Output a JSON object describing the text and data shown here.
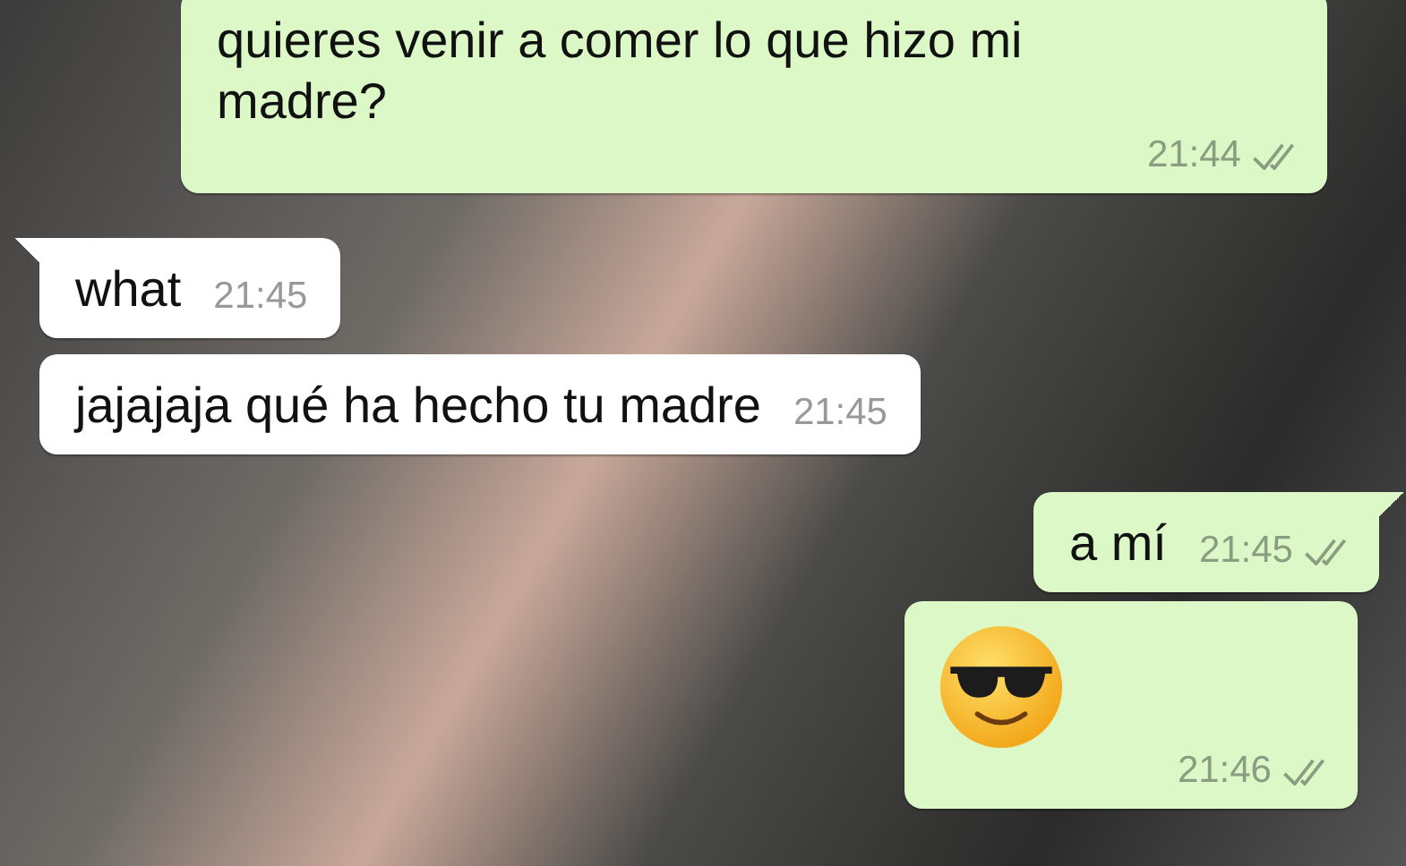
{
  "messages": [
    {
      "kind": "sent_text",
      "text": "quieres venir a comer lo que hizo mi madre?",
      "time": "21:44",
      "tail": false
    },
    {
      "kind": "received_text",
      "text": "what",
      "time": "21:45",
      "tail": true
    },
    {
      "kind": "received_text",
      "text": "jajajaja qué ha hecho tu madre",
      "time": "21:45",
      "tail": false
    },
    {
      "kind": "sent_text",
      "text": "a mí",
      "time": "21:45",
      "tail": true
    },
    {
      "kind": "sent_emoji",
      "time": "21:46",
      "tail": false
    }
  ]
}
